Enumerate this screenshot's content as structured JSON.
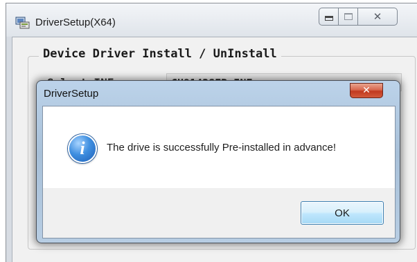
{
  "main_window": {
    "title": "DriverSetup(X64)",
    "group_title": "Device Driver Install / UnInstall",
    "obscured_label": "Select INF",
    "obscured_field_value": "CH9143SER.INF"
  },
  "dialog": {
    "title": "DriverSetup",
    "message": "The drive is successfully Pre-installed in advance!",
    "ok_label": "OK",
    "icon": "info-icon"
  },
  "colors": {
    "close_button": "#c1391f",
    "ok_button_border": "#3c7fb1",
    "info_icon": "#1d5fb8"
  }
}
